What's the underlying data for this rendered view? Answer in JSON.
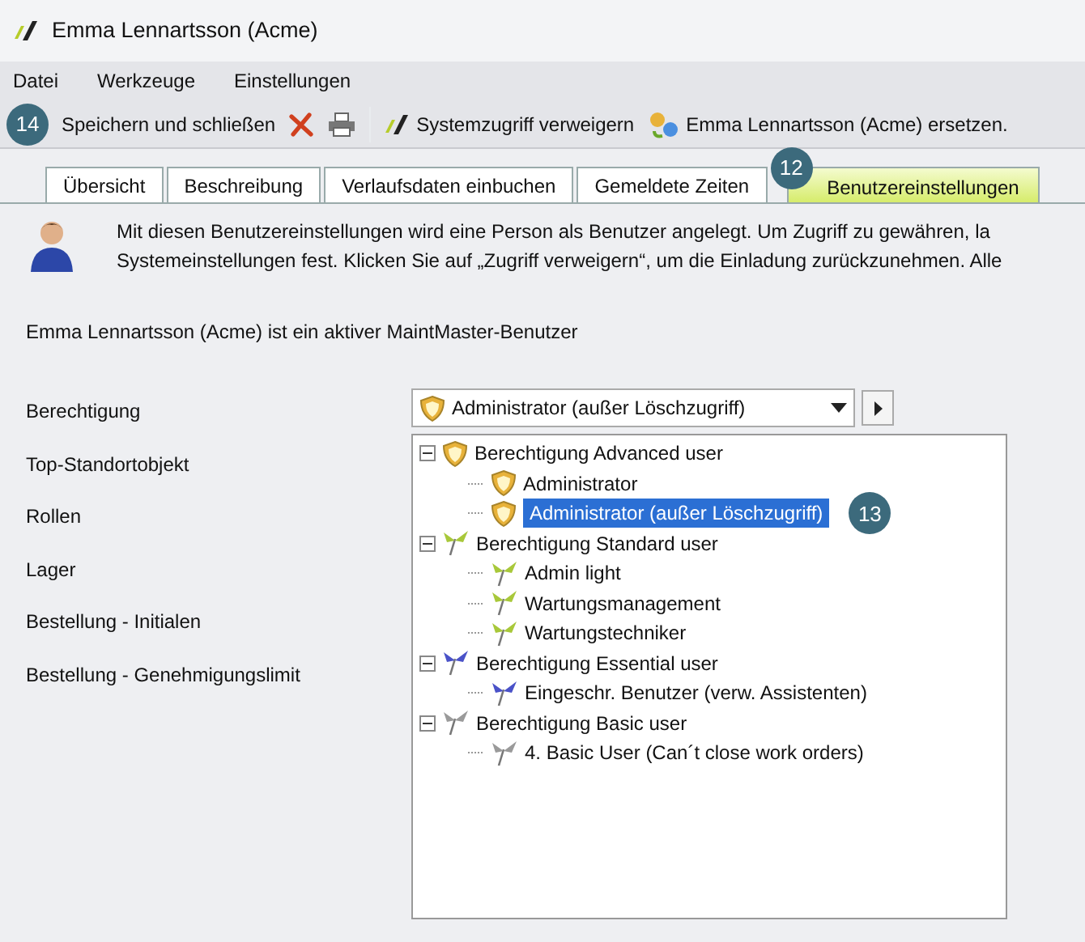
{
  "window": {
    "title": "Emma Lennartsson (Acme)"
  },
  "menu": [
    "Datei",
    "Werkzeuge",
    "Einstellungen"
  ],
  "toolbar": [
    {
      "kind": "callout",
      "label": "14"
    },
    {
      "kind": "text",
      "label": "Speichern und schließen"
    },
    {
      "kind": "delete"
    },
    {
      "kind": "print"
    },
    {
      "kind": "sep"
    },
    {
      "kind": "logo",
      "label": "Systemzugriff verweigern"
    },
    {
      "kind": "replace",
      "label": "Emma Lennartsson (Acme) ersetzen."
    }
  ],
  "tabs": [
    {
      "label": "Übersicht",
      "selected": false
    },
    {
      "label": "Beschreibung",
      "selected": false
    },
    {
      "label": "Verlaufsdaten einbuchen",
      "selected": false
    },
    {
      "label": "Gemeldete Zeiten",
      "selected": false
    },
    {
      "label": "Benutzereinstellungen",
      "selected": true,
      "callout": "12"
    }
  ],
  "info": "Mit diesen Benutzereinstellungen wird eine Person als Benutzer angelegt. Um Zugriff zu gewähren, la",
  "info_2": "Systemeinstellungen fest. Klicken Sie auf „Zugriff verweigern“, um die Einladung zurückzunehmen. Alle",
  "status": "Emma Lennartsson (Acme) ist ein aktiver MaintMaster-Benutzer",
  "fields": [
    "Berechtigung",
    "Top-Standortobjekt",
    "Rollen",
    "Lager",
    "Bestellung - Initialen",
    "Bestellung - Genehmigungslimit"
  ],
  "dropdown": {
    "value": "Administrator (außer Löschzugriff)"
  },
  "tree": [
    {
      "label": "Berechtigung Advanced user",
      "kind": "shield",
      "expanded": true,
      "selected": false,
      "children": [
        {
          "label": "Administrator",
          "kind": "shield",
          "selected": false
        },
        {
          "label": "Administrator (außer Löschzugriff)",
          "kind": "shield",
          "selected": true,
          "callout": "13"
        }
      ]
    },
    {
      "label": "Berechtigung Standard user",
      "kind": "green",
      "expanded": true,
      "selected": false,
      "children": [
        {
          "label": "Admin light",
          "kind": "green",
          "selected": false
        },
        {
          "label": "Wartungsmanagement",
          "kind": "green",
          "selected": false
        },
        {
          "label": "Wartungstechniker",
          "kind": "green",
          "selected": false
        }
      ]
    },
    {
      "label": "Berechtigung Essential user",
      "kind": "blue",
      "expanded": true,
      "selected": false,
      "children": [
        {
          "label": "Eingeschr. Benutzer (verw. Assistenten)",
          "kind": "blue",
          "selected": false
        }
      ]
    },
    {
      "label": "Berechtigung Basic user",
      "kind": "gray",
      "expanded": true,
      "selected": false,
      "children": [
        {
          "label": "4. Basic User (Can´t close work orders)",
          "kind": "gray",
          "selected": false
        }
      ]
    }
  ]
}
